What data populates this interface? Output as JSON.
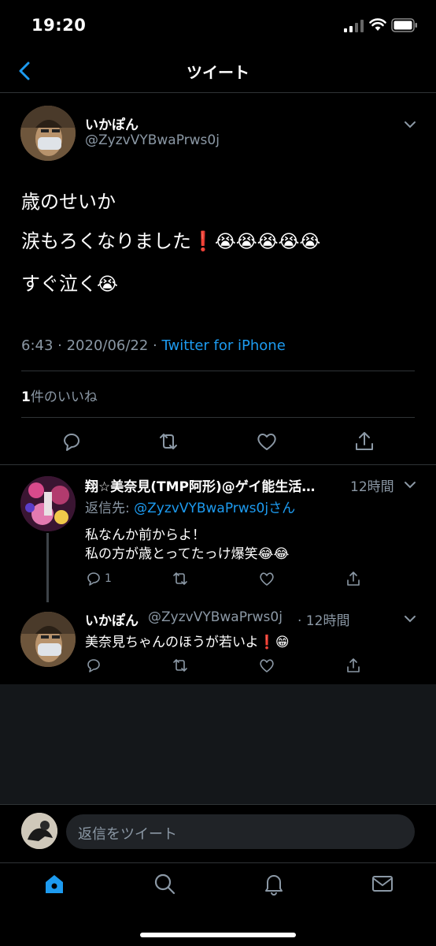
{
  "status_bar": {
    "time": "19:20"
  },
  "nav": {
    "title": "ツイート"
  },
  "main_tweet": {
    "name": "いかぽん",
    "handle": "@ZyzvVYBwaPrws0j",
    "line1": "歳のせいか",
    "line2_text": "涙もろくなりました",
    "line2_exclaim": "❗",
    "line2_emojis": "😭😭😭😭😭",
    "line3_text": "すぐ泣く",
    "line3_emoji": "😭",
    "timestamp": "6:43 · 2020/06/22 · ",
    "client": "Twitter for iPhone",
    "likes_count": "1",
    "likes_label": "件のいいね"
  },
  "replies": [
    {
      "name": "翔☆美奈見(TMP阿形)@ゲイ能生活…",
      "time": "12時間",
      "reply_to_prefix": "返信先: ",
      "reply_to_handle": "@ZyzvVYBwaPrws0jさん",
      "line1": "私なんか前からよ！",
      "line2": "私の方が歳とってたっけ爆笑",
      "line2_emojis": "😂😂",
      "reply_count": "1"
    },
    {
      "name": "いかぽん",
      "handle": "@ZyzvVYBwaPrws0j",
      "time": "· 12時間",
      "line1": "美奈見ちゃんのほうが若いよ",
      "line1_exclaim": "❗",
      "line1_emoji": "😁"
    }
  ],
  "compose": {
    "placeholder": "返信をツイート"
  },
  "colors": {
    "accent": "#1d9bf0",
    "secondary_text": "#8b98a5",
    "divider": "#2f3336"
  }
}
